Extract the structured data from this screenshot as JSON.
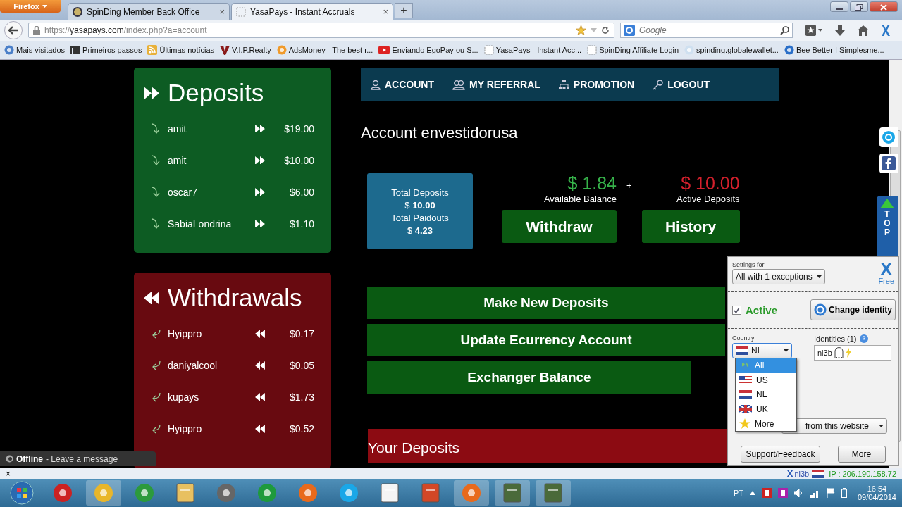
{
  "browser": {
    "menu_button": "Firefox",
    "tabs": [
      {
        "title": "SpinDing Member Back Office",
        "selected": false,
        "close": "×"
      },
      {
        "title": "YasaPays - Instant Accruals",
        "selected": true,
        "close": "×"
      }
    ],
    "new_tab": "+",
    "url": {
      "scheme": "https://",
      "host": "yasapays.com",
      "path": "/index.php?a=account"
    },
    "search": {
      "placeholder": "Google"
    },
    "bookmarks": [
      {
        "label": "Mais visitados"
      },
      {
        "label": "Primeiros passos"
      },
      {
        "label": "Últimas notícias"
      },
      {
        "label": "V.I.P.Realty"
      },
      {
        "label": "AdsMoney - The best r..."
      },
      {
        "label": "Enviando EgoPay ou S..."
      },
      {
        "label": "YasaPays - Instant Acc..."
      },
      {
        "label": "SpinDing Affiliate Login"
      },
      {
        "label": "spinding.globalewallet..."
      },
      {
        "label": "Bee Better I Simplesme..."
      }
    ]
  },
  "deposits": {
    "title": "Deposits",
    "rows": [
      {
        "name": "amit",
        "amount": "$19.00"
      },
      {
        "name": "amit",
        "amount": "$10.00"
      },
      {
        "name": "oscar7",
        "amount": "$6.00"
      },
      {
        "name": "SabiaLondrina",
        "amount": "$1.10"
      }
    ]
  },
  "withdrawals": {
    "title": "Withdrawals",
    "rows": [
      {
        "name": "Hyippro",
        "amount": "$0.17"
      },
      {
        "name": "daniyalcool",
        "amount": "$0.05"
      },
      {
        "name": "kupays",
        "amount": "$1.73"
      },
      {
        "name": "Hyippro",
        "amount": "$0.52"
      }
    ]
  },
  "nav": [
    {
      "label": "ACCOUNT"
    },
    {
      "label": "MY REFERRAL"
    },
    {
      "label": "PROMOTION"
    },
    {
      "label": "LOGOUT"
    }
  ],
  "account": {
    "title": "Account envestidorusa",
    "totals": [
      {
        "label": "Total Deposits",
        "value": "$ **10.00**"
      },
      {
        "label": "Total Paidouts",
        "value": "$ **4.23**"
      }
    ],
    "balances": [
      {
        "amount": "$ 1.84",
        "label": "Available Balance",
        "color": "#36b24a",
        "button": "Withdraw"
      },
      {
        "amount": "$ 10.00",
        "label": "Active Deposits",
        "color": "#d3202c",
        "button": "History"
      }
    ],
    "plus": "+",
    "actions": [
      {
        "label": "Make New Deposits"
      },
      {
        "label": "Update Ecurrency Account"
      },
      {
        "label": "Exchanger Balance"
      }
    ],
    "your_deposits": "Your Deposits"
  },
  "side": {
    "top": "TOP"
  },
  "popup": {
    "settings_label": "Settings for",
    "settings_value": "All with 1 exceptions",
    "logo": "X",
    "plan": "Free",
    "active": {
      "label": "Active",
      "checked": true
    },
    "change_button": "Change identity",
    "country_label": "Country",
    "country_value": "NL",
    "country_options": [
      {
        "label": "All",
        "selected": true
      },
      {
        "label": "US",
        "selected": false
      },
      {
        "label": "NL",
        "selected": false
      },
      {
        "label": "UK",
        "selected": false
      },
      {
        "label": "More",
        "selected": false
      }
    ],
    "identities_label": "Identities (1)",
    "identity_value": "nl3b",
    "cookies_value": "from this website",
    "buttons": [
      {
        "label": "Support/Feedback"
      },
      {
        "label": "More"
      }
    ]
  },
  "chat": {
    "status": "Offline",
    "message": "- Leave a message"
  },
  "status_strip": {
    "close": "×",
    "logo": "X",
    "identity": "nl3b",
    "ip": "IP : 206.190.158.72"
  },
  "taskbar": {
    "language": "PT",
    "time": "16:54",
    "date": "09/04/2014"
  }
}
